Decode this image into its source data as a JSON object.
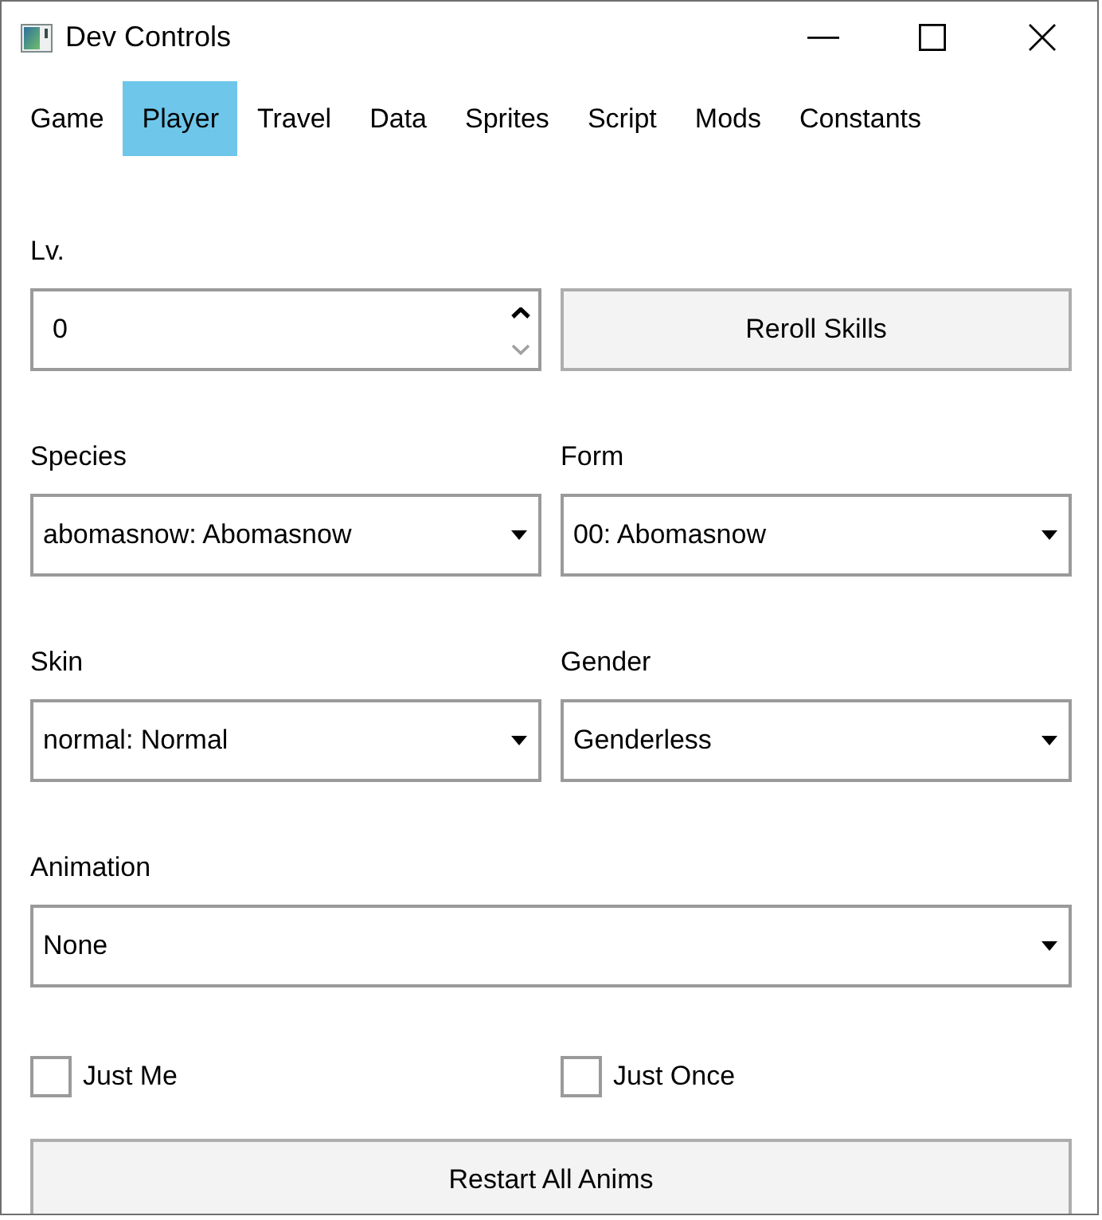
{
  "window": {
    "title": "Dev Controls"
  },
  "tabs": [
    {
      "label": "Game",
      "selected": false
    },
    {
      "label": "Player",
      "selected": true
    },
    {
      "label": "Travel",
      "selected": false
    },
    {
      "label": "Data",
      "selected": false
    },
    {
      "label": "Sprites",
      "selected": false
    },
    {
      "label": "Script",
      "selected": false
    },
    {
      "label": "Mods",
      "selected": false
    },
    {
      "label": "Constants",
      "selected": false
    }
  ],
  "level": {
    "label": "Lv.",
    "value": "0",
    "increment_disabled": false,
    "decrement_disabled": true
  },
  "reroll_button": "Reroll Skills",
  "dropdowns": [
    {
      "label": "Species",
      "value": "abomasnow: Abomasnow"
    },
    {
      "label": "Form",
      "value": "00: Abomasnow"
    },
    {
      "label": "Skin",
      "value": "normal: Normal"
    },
    {
      "label": "Gender",
      "value": "Genderless"
    },
    {
      "label": "Animation",
      "value": "None"
    }
  ],
  "checkboxes": [
    {
      "label": "Just Me",
      "checked": false
    },
    {
      "label": "Just Once",
      "checked": false
    }
  ],
  "restart_button": "Restart All Anims"
}
